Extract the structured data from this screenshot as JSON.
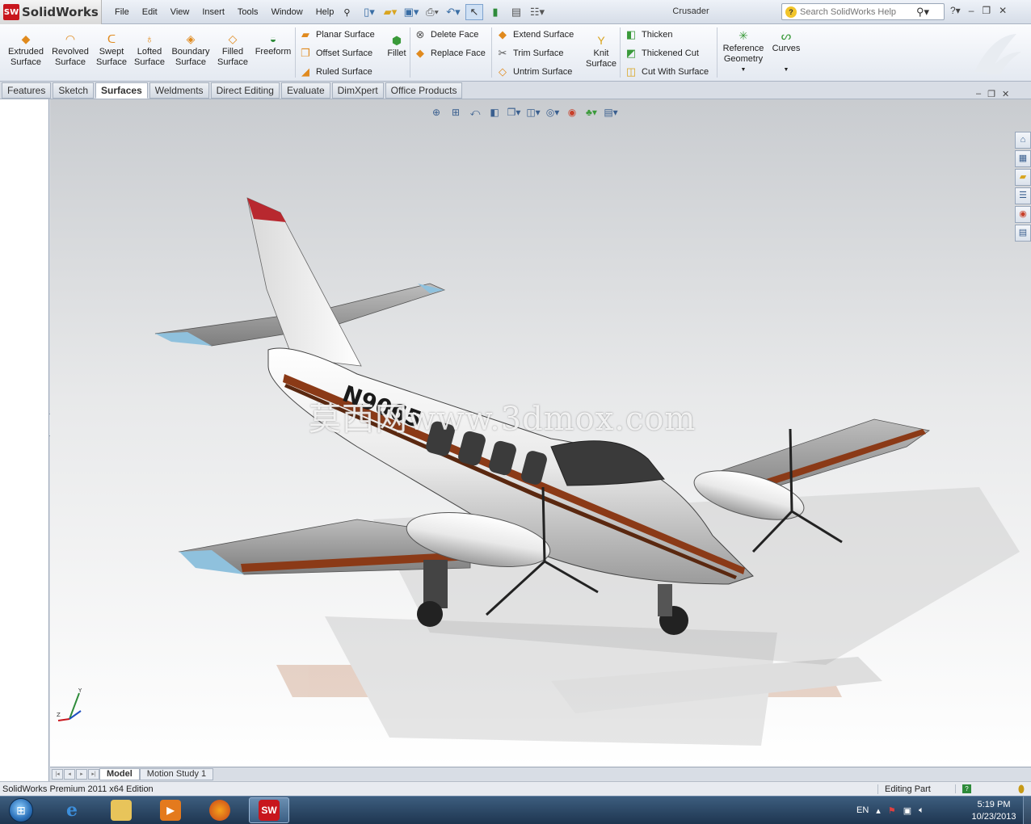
{
  "app": {
    "logo_text": "SolidWorks",
    "logo_badge": "SW",
    "document_title": "Crusader"
  },
  "menu": [
    "File",
    "Edit",
    "View",
    "Insert",
    "Tools",
    "Window",
    "Help"
  ],
  "search": {
    "placeholder": "Search SolidWorks Help"
  },
  "quick_access_icons": [
    "new-document-icon",
    "open-icon",
    "save-icon",
    "print-icon",
    "undo-icon",
    "select-icon",
    "rebuild-icon",
    "file-properties-icon",
    "options-icon"
  ],
  "command_manager": {
    "big_buttons": [
      {
        "label": "Extruded\nSurface",
        "icon": "extruded-surface-icon"
      },
      {
        "label": "Revolved\nSurface",
        "icon": "revolved-surface-icon"
      },
      {
        "label": "Swept\nSurface",
        "icon": "swept-surface-icon"
      },
      {
        "label": "Lofted\nSurface",
        "icon": "lofted-surface-icon"
      },
      {
        "label": "Boundary\nSurface",
        "icon": "boundary-surface-icon"
      },
      {
        "label": "Filled\nSurface",
        "icon": "filled-surface-icon"
      },
      {
        "label": "Freeform",
        "icon": "freeform-icon"
      }
    ],
    "group1": [
      "Planar Surface",
      "Offset Surface",
      "Ruled Surface"
    ],
    "fillet": "Fillet",
    "group2": [
      "Delete Face",
      "Replace Face"
    ],
    "group3": [
      "Extend Surface",
      "Trim Surface",
      "Untrim Surface"
    ],
    "knit": "Knit\nSurface",
    "group4": [
      "Thicken",
      "Thickened Cut",
      "Cut With Surface"
    ],
    "reference_geometry": "Reference\nGeometry",
    "curves": "Curves"
  },
  "tabs": [
    "Features",
    "Sketch",
    "Surfaces",
    "Weldments",
    "Direct Editing",
    "Evaluate",
    "DimXpert",
    "Office Products"
  ],
  "active_tab": "Surfaces",
  "viewport": {
    "watermark": "莫西网www.3dmox.com",
    "aircraft_registration": "N9065",
    "headsup_icons": [
      "zoom-to-fit-icon",
      "zoom-area-icon",
      "previous-view-icon",
      "section-view-icon",
      "view-orientation-icon",
      "display-style-icon",
      "hide-show-icon",
      "edit-appearance-icon",
      "apply-scene-icon",
      "view-settings-icon"
    ],
    "task_pane_icons": [
      "home-icon",
      "design-library-icon",
      "file-explorer-icon",
      "view-palette-icon",
      "appearances-icon",
      "custom-properties-icon"
    ]
  },
  "bottom_tabs": [
    "Model",
    "Motion Study 1"
  ],
  "status": {
    "left": "SolidWorks Premium 2011 x64 Edition",
    "mode": "Editing Part",
    "help": "?"
  },
  "taskbar": {
    "apps": [
      "internet-explorer-icon",
      "file-explorer-icon",
      "media-player-icon",
      "firefox-icon",
      "solidworks-icon"
    ],
    "language": "EN",
    "time": "5:19 PM",
    "date": "10/23/2013"
  },
  "colors": {
    "accent": "#c8161d",
    "fuselage": "#f2f2f2",
    "stripe": "#8b3a17",
    "wingtip": "#7fb6d6"
  }
}
